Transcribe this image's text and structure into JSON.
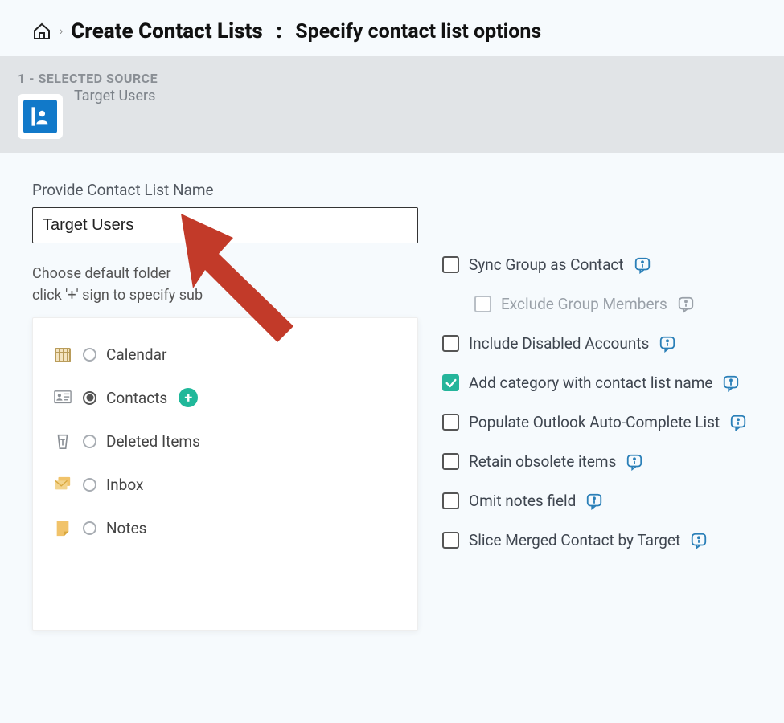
{
  "breadcrumb": {
    "title": "Create Contact Lists",
    "subtitle": "Specify contact list options"
  },
  "source": {
    "step_label": "1 - SELECTED SOURCE",
    "name": "Target Users"
  },
  "form": {
    "name_label": "Provide Contact List Name",
    "name_value": "Target Users",
    "help_line1": "Choose default folder",
    "help_line2": "click '+' sign to specify sub"
  },
  "folders": [
    {
      "id": "calendar",
      "label": "Calendar",
      "selected": false
    },
    {
      "id": "contacts",
      "label": "Contacts",
      "selected": true,
      "add": true
    },
    {
      "id": "deleted",
      "label": "Deleted Items",
      "selected": false
    },
    {
      "id": "inbox",
      "label": "Inbox",
      "selected": false
    },
    {
      "id": "notes",
      "label": "Notes",
      "selected": false
    }
  ],
  "options": [
    {
      "id": "sync_group",
      "label": "Sync Group as Contact",
      "checked": false,
      "indent": false
    },
    {
      "id": "excl_members",
      "label": "Exclude Group Members",
      "checked": false,
      "indent": true,
      "disabled": true
    },
    {
      "id": "incl_disabled",
      "label": "Include Disabled Accounts",
      "checked": false,
      "indent": false
    },
    {
      "id": "add_category",
      "label": "Add category with contact list name",
      "checked": true,
      "indent": false
    },
    {
      "id": "populate_ac",
      "label": "Populate Outlook Auto-Complete List",
      "checked": false,
      "indent": false
    },
    {
      "id": "retain_obs",
      "label": "Retain obsolete items",
      "checked": false,
      "indent": false
    },
    {
      "id": "omit_notes",
      "label": "Omit notes field",
      "checked": false,
      "indent": false
    },
    {
      "id": "slice_merged",
      "label": "Slice Merged Contact by Target",
      "checked": false,
      "indent": false
    }
  ]
}
